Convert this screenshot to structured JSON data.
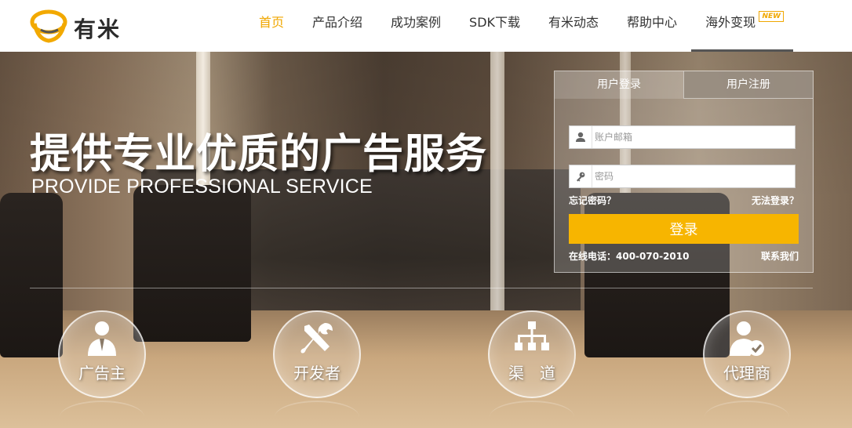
{
  "header": {
    "logo_text": "有米",
    "nav": [
      {
        "label": "首页",
        "active": true
      },
      {
        "label": "产品介绍"
      },
      {
        "label": "成功案例"
      },
      {
        "label": "SDK下载"
      },
      {
        "label": "有米动态"
      },
      {
        "label": "帮助中心"
      },
      {
        "label": "海外变现",
        "badge": "NEW"
      }
    ]
  },
  "hero": {
    "title": "提供专业优质的广告服务",
    "subtitle": "PROVIDE PROFESSIONAL SERVICE"
  },
  "login": {
    "tab_login": "用户登录",
    "tab_register": "用户注册",
    "email_placeholder": "账户邮箱",
    "password_placeholder": "密码",
    "forgot": "忘记密码？",
    "cannot_login": "无法登录？",
    "submit": "登录",
    "phone": "在线电话：400-070-2010",
    "contact": "联系我们"
  },
  "roles": [
    {
      "label": "广告主",
      "icon": "advertiser-icon"
    },
    {
      "label": "开发者",
      "icon": "developer-tools-icon"
    },
    {
      "label": "渠　道",
      "icon": "channel-tree-icon"
    },
    {
      "label": "代理商",
      "icon": "agent-check-icon"
    }
  ],
  "colors": {
    "accent": "#f7b500",
    "nav_active": "#f0a700"
  }
}
